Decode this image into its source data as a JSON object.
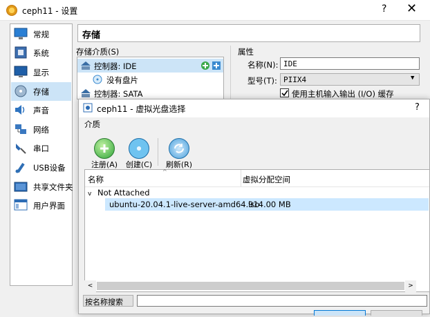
{
  "main_window": {
    "title": "ceph11 - 设置",
    "help": "?",
    "close": "✕",
    "section_title": "存储",
    "storage_medium_label": "存储介质(S)",
    "attributes_label": "属性",
    "sidebar": [
      {
        "label": "常规",
        "icon": "monitor-general-icon"
      },
      {
        "label": "系统",
        "icon": "chip-system-icon"
      },
      {
        "label": "显示",
        "icon": "display-icon"
      },
      {
        "label": "存储",
        "icon": "storage-disk-icon",
        "selected": true
      },
      {
        "label": "声音",
        "icon": "speaker-icon"
      },
      {
        "label": "网络",
        "icon": "network-icon"
      },
      {
        "label": "串口",
        "icon": "serial-port-icon"
      },
      {
        "label": "USB设备",
        "icon": "usb-icon"
      },
      {
        "label": "共享文件夹",
        "icon": "shared-folder-icon"
      },
      {
        "label": "用户界面",
        "icon": "user-interface-icon"
      }
    ],
    "tree": {
      "controller_ide": "控制器: IDE",
      "empty_disk": "没有盘片",
      "controller_sata": "控制器: SATA"
    },
    "attrs": {
      "name_label": "名称(N):",
      "name_value": "IDE",
      "type_label": "型号(T):",
      "type_value": "PIIX4",
      "cache_label": "使用主机输入输出 (I/O) 缓存"
    }
  },
  "dialog": {
    "title": "ceph11 - 虚拟光盘选择",
    "help": "?",
    "menu": "介质",
    "toolbar": [
      {
        "label": "注册(A)",
        "icon": "register-add-icon"
      },
      {
        "label": "创建(C)",
        "icon": "create-disc-icon"
      },
      {
        "label": "刷新(R)",
        "icon": "refresh-icon"
      }
    ],
    "columns": [
      "名称",
      "虚拟分配空间"
    ],
    "group": "Not Attached",
    "rows": [
      {
        "name": "ubuntu-20.04.1-live-server-amd64.iso",
        "size": "914.00 MB"
      }
    ],
    "search_label": "按名称搜索",
    "search_value": ""
  }
}
